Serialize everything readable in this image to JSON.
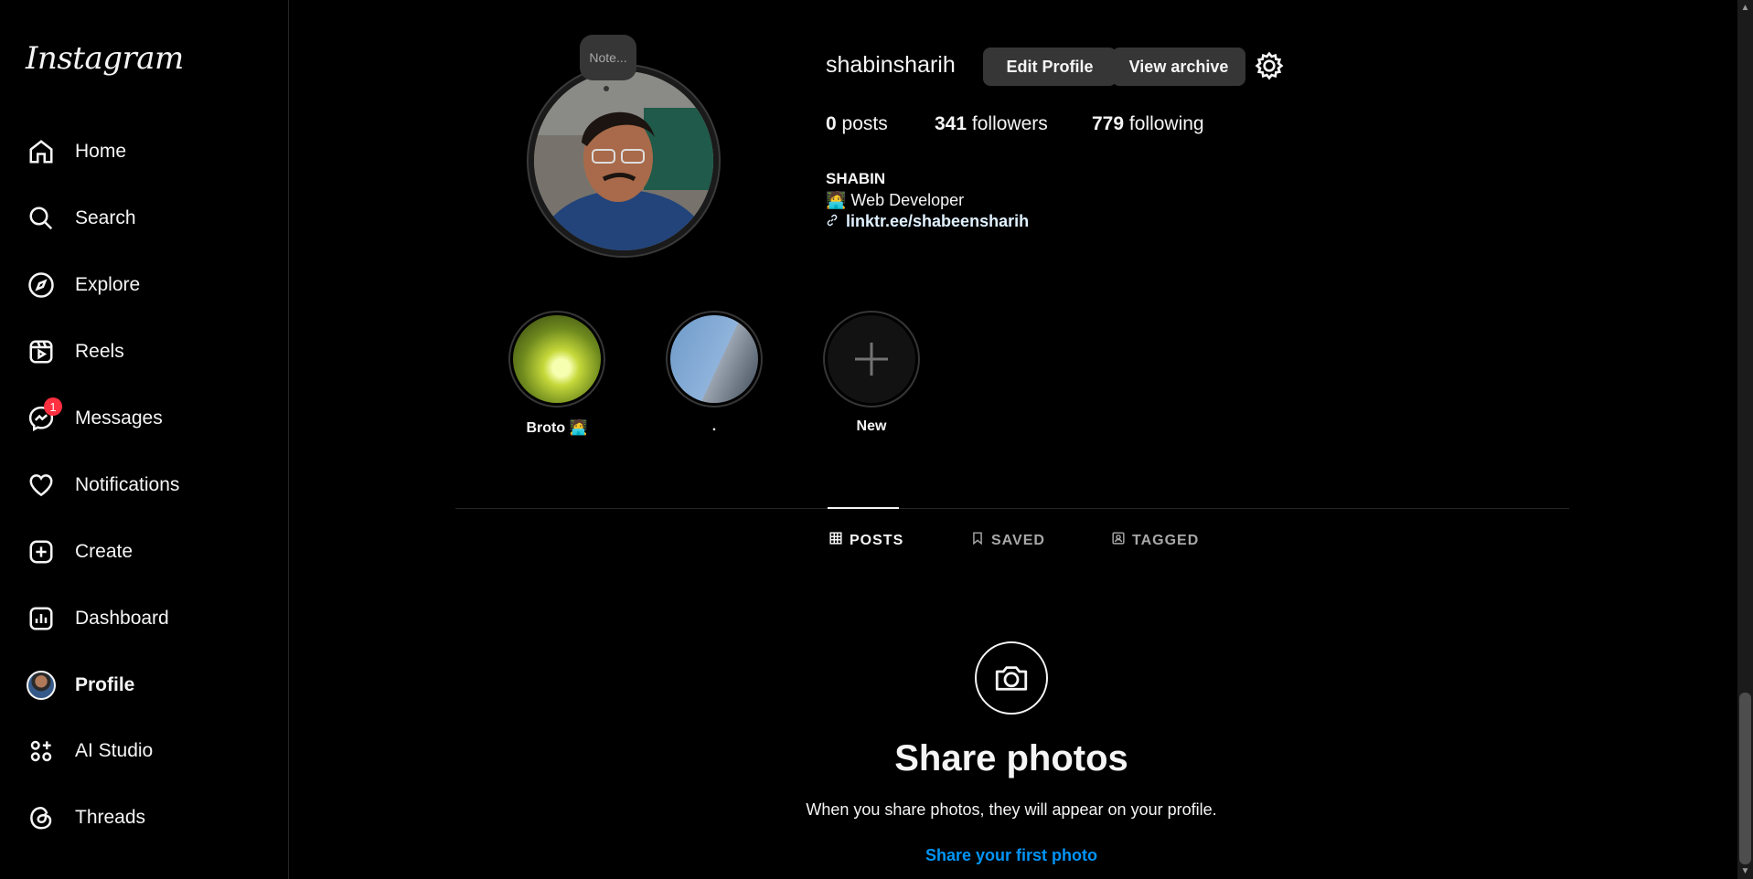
{
  "app": {
    "logo": "Instagram"
  },
  "sidebar": {
    "items": [
      {
        "label": "Home",
        "icon": "home-icon"
      },
      {
        "label": "Search",
        "icon": "search-icon"
      },
      {
        "label": "Explore",
        "icon": "compass-icon"
      },
      {
        "label": "Reels",
        "icon": "reels-icon"
      },
      {
        "label": "Messages",
        "icon": "messenger-icon",
        "badge": "1"
      },
      {
        "label": "Notifications",
        "icon": "heart-icon"
      },
      {
        "label": "Create",
        "icon": "plus-square-icon"
      },
      {
        "label": "Dashboard",
        "icon": "dashboard-icon"
      },
      {
        "label": "Profile",
        "icon": "avatar"
      },
      {
        "label": "AI Studio",
        "icon": "ai-studio-icon"
      },
      {
        "label": "Threads",
        "icon": "threads-icon"
      }
    ]
  },
  "profile": {
    "note": "Note...",
    "username": "shabinsharih",
    "edit_label": "Edit Profile",
    "archive_label": "View archive",
    "stats": {
      "posts_count": "0",
      "posts_label": "posts",
      "followers_count": "341",
      "followers_label": "followers",
      "following_count": "779",
      "following_label": "following"
    },
    "bio": {
      "name": "SHABIN",
      "emoji": "🧑‍💻",
      "line": "Web Developer",
      "link": "linktr.ee/shabeensharih"
    }
  },
  "highlights": [
    {
      "label": "Broto 🧑‍💻"
    },
    {
      "label": "."
    },
    {
      "label": "New"
    }
  ],
  "tabs": [
    {
      "label": "POSTS",
      "icon": "grid-icon",
      "active": true
    },
    {
      "label": "SAVED",
      "icon": "bookmark-icon",
      "active": false
    },
    {
      "label": "TAGGED",
      "icon": "tagged-icon",
      "active": false
    }
  ],
  "empty": {
    "title": "Share photos",
    "subtitle": "When you share photos, they will appear on your profile.",
    "cta": "Share your first photo"
  },
  "colors": {
    "link": "#0095f6",
    "badge": "#ff3040",
    "button": "#363636"
  }
}
